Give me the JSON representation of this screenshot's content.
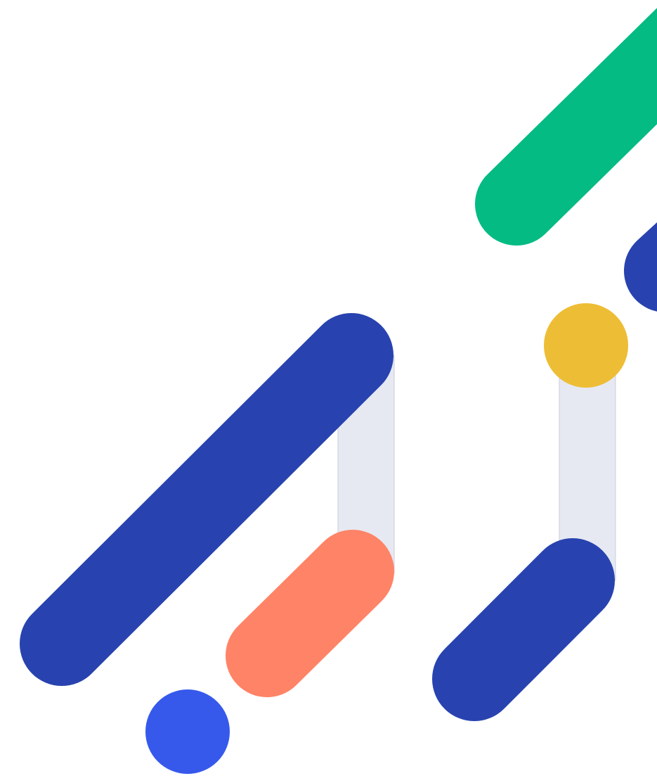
{
  "colors": {
    "background": "#ffffff",
    "green": "#04BB83",
    "navy": "#2843AF",
    "yellow": "#EDBD35",
    "coral": "#FF8366",
    "blue": "#3659EC",
    "connector_fill": "#E6E9F2",
    "connector_stroke": "#C9CDD9"
  },
  "shapes": [
    {
      "name": "green-diagonal-bar",
      "kind": "capsule",
      "color": "green"
    },
    {
      "name": "navy-top-right-bar",
      "kind": "capsule",
      "color": "navy"
    },
    {
      "name": "yellow-dot",
      "kind": "circle",
      "color": "yellow"
    },
    {
      "name": "right-connector",
      "kind": "connector",
      "color": "connector_fill"
    },
    {
      "name": "navy-bottom-right-bar",
      "kind": "capsule",
      "color": "navy"
    },
    {
      "name": "left-connector",
      "kind": "connector",
      "color": "connector_fill"
    },
    {
      "name": "navy-long-diagonal-bar",
      "kind": "capsule",
      "color": "navy"
    },
    {
      "name": "coral-diagonal-bar",
      "kind": "capsule",
      "color": "coral"
    },
    {
      "name": "blue-dot",
      "kind": "circle",
      "color": "blue"
    }
  ]
}
